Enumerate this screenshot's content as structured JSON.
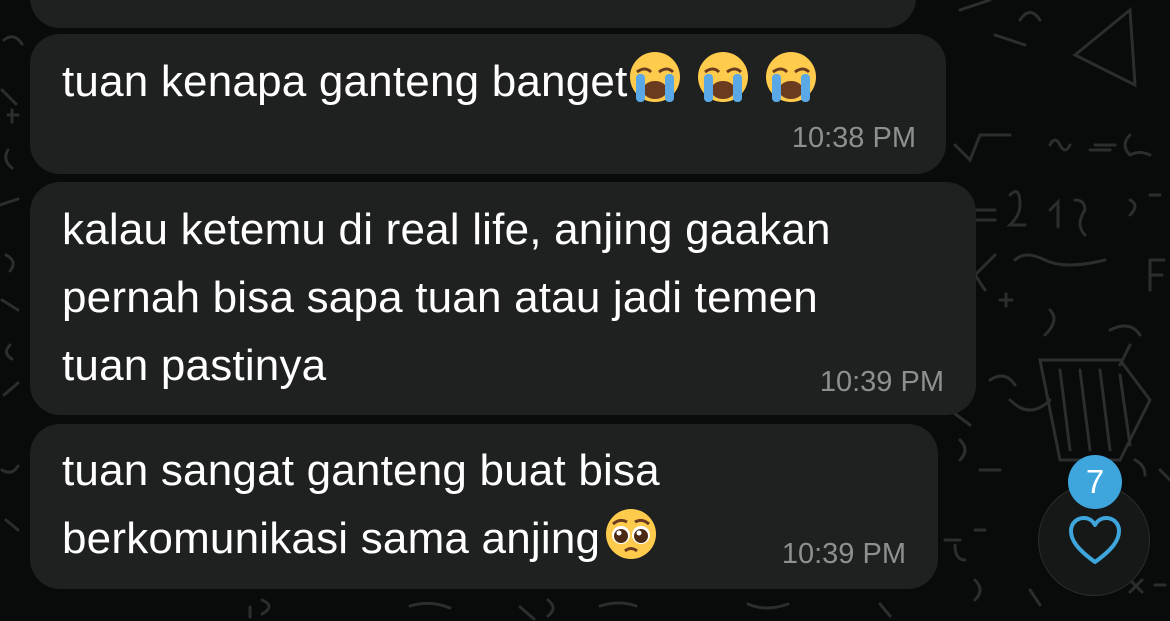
{
  "chat": {
    "messages": [
      {
        "text": "tuan kenapa ganteng banget",
        "emoji": [
          "loudly-crying-face",
          "loudly-crying-face",
          "loudly-crying-face"
        ],
        "time": "10:38 PM"
      },
      {
        "lines": [
          "kalau ketemu di real life, anjing gaakan",
          "pernah bisa sapa tuan atau jadi temen",
          "tuan pastinya"
        ],
        "time": "10:39 PM"
      },
      {
        "lines": [
          "tuan sangat ganteng buat bisa",
          "berkomunikasi sama anjing"
        ],
        "emoji": [
          "pleading-face"
        ],
        "time": "10:39 PM"
      }
    ]
  },
  "reaction": {
    "count": "7",
    "icon": "heart-outline-icon",
    "color": "#3ea6dd"
  },
  "colors": {
    "background": "#090a0a",
    "bubble": "#1f2020",
    "timestamp": "#8e8f90"
  }
}
